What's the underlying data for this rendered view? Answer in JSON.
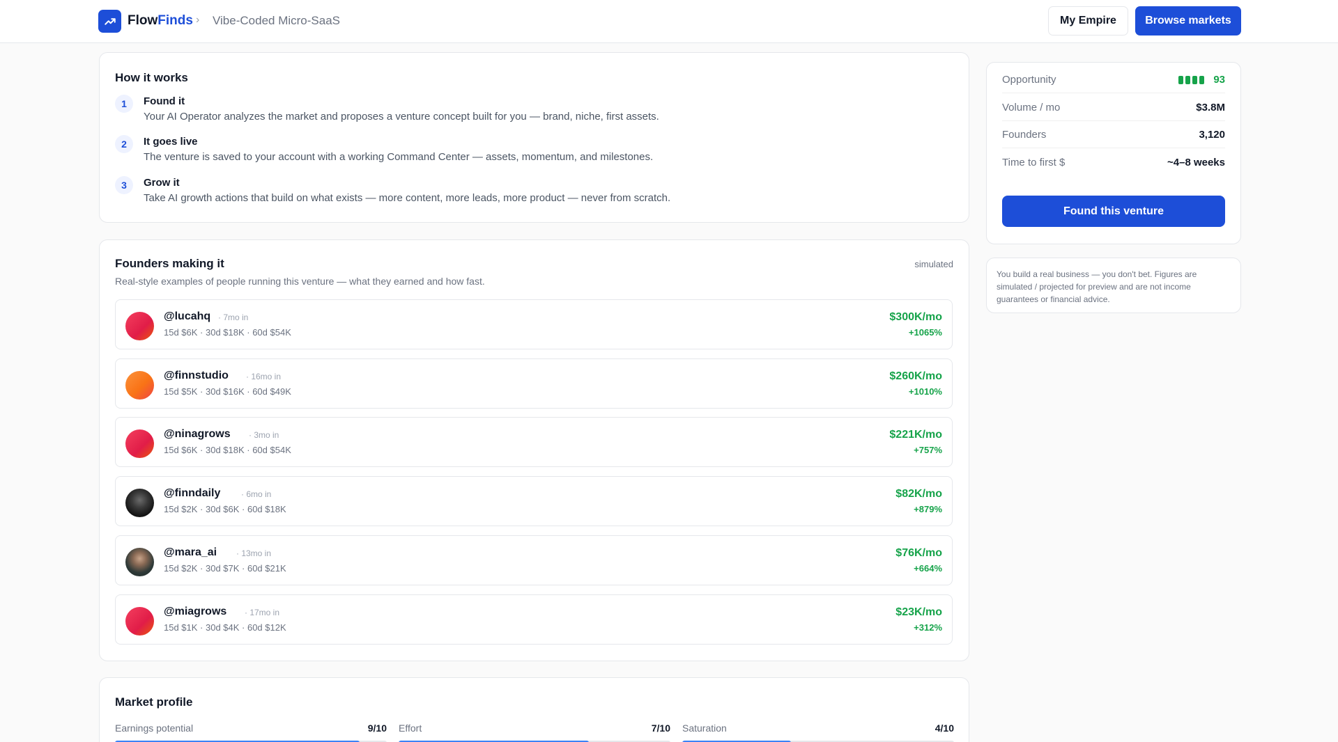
{
  "header": {
    "brand_main": "Flow",
    "brand_accent": "Finds",
    "breadcrumb_sep": "›",
    "breadcrumb": "Vibe-Coded Micro-SaaS",
    "my_empire_label": "My Empire",
    "browse_label": "Browse markets"
  },
  "how_it_works": {
    "title": "How it works",
    "steps": [
      {
        "num": "1",
        "title": "Found it",
        "desc": "Your AI Operator analyzes the market and proposes a venture concept built for you — brand, niche, first assets."
      },
      {
        "num": "2",
        "title": "It goes live",
        "desc": "The venture is saved to your account with a working Command Center — assets, momentum, and milestones."
      },
      {
        "num": "3",
        "title": "Grow it",
        "desc": "Take AI growth actions that build on what exists — more content, more leads, more product — never from scratch."
      }
    ]
  },
  "founders": {
    "title": "Founders making it",
    "tag": "simulated",
    "subtitle": "Real-style examples of people running this venture — what they earned and how fast.",
    "rows": [
      {
        "handle": "@lucahq",
        "tenure": "· 7mo in",
        "stats": "15d $6K · 30d $18K · 60d $54K",
        "mrr": "$300K/mo",
        "growth": "+1065%"
      },
      {
        "handle": "@finnstudio",
        "tenure": "· 16mo in",
        "stats": "15d $5K · 30d $16K · 60d $49K",
        "mrr": "$260K/mo",
        "growth": "+1010%"
      },
      {
        "handle": "@ninagrows",
        "tenure": "· 3mo in",
        "stats": "15d $6K · 30d $18K · 60d $54K",
        "mrr": "$221K/mo",
        "growth": "+757%"
      },
      {
        "handle": "@finndaily",
        "tenure": "· 6mo in",
        "stats": "15d $2K · 30d $6K · 60d $18K",
        "mrr": "$82K/mo",
        "growth": "+879%"
      },
      {
        "handle": "@mara_ai",
        "tenure": "· 13mo in",
        "stats": "15d $2K · 30d $7K · 60d $21K",
        "mrr": "$76K/mo",
        "growth": "+664%"
      },
      {
        "handle": "@miagrows",
        "tenure": "· 17mo in",
        "stats": "15d $1K · 30d $4K · 60d $12K",
        "mrr": "$23K/mo",
        "growth": "+312%"
      }
    ]
  },
  "market_profile": {
    "title": "Market profile",
    "metrics": [
      {
        "label": "Earnings potential",
        "value": "9/10",
        "fraction": 0.9
      },
      {
        "label": "Effort",
        "value": "7/10",
        "fraction": 0.7
      },
      {
        "label": "Saturation",
        "value": "4/10",
        "fraction": 0.4
      }
    ]
  },
  "summary": {
    "opportunity_label": "Opportunity",
    "opportunity_score": "93",
    "volume_label": "Volume / mo",
    "volume_value": "$3.8M",
    "founders_label": "Founders",
    "founders_value": "3,120",
    "time_label": "Time to first $",
    "time_value": "~4–8 weeks",
    "cta_label": "Found this venture"
  },
  "disclaimer": "You build a real business — you don't bet. Figures are simulated / projected for preview and are not income guarantees or financial advice.",
  "colors": {
    "accent": "#1d4ed8",
    "positive": "#16a34a",
    "bar_fill": "#3b82f6"
  }
}
